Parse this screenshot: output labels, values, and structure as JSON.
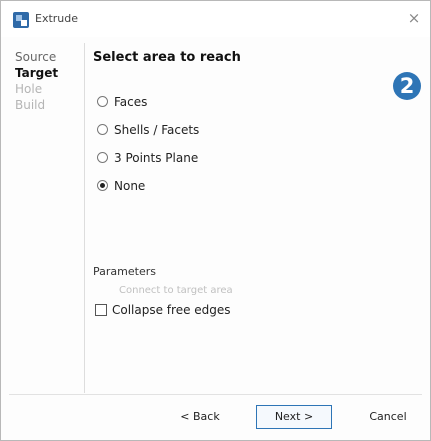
{
  "window": {
    "title": "Extrude",
    "close_glyph": "×"
  },
  "steps": [
    {
      "label": "Source",
      "state": "normal"
    },
    {
      "label": "Target",
      "state": "active"
    },
    {
      "label": "Hole",
      "state": "disabled"
    },
    {
      "label": "Build",
      "state": "disabled"
    }
  ],
  "main": {
    "title": "Select area to reach",
    "step_badge": "2",
    "options": [
      {
        "label": "Faces",
        "checked": false
      },
      {
        "label": "Shells / Facets",
        "checked": false
      },
      {
        "label": "3 Points Plane",
        "checked": false
      },
      {
        "label": "None",
        "checked": true
      }
    ],
    "parameters_label": "Parameters",
    "disabled_option": "Connect to target area",
    "collapse_label": "Collapse free edges",
    "collapse_checked": false
  },
  "footer": {
    "back": "< Back",
    "next": "Next >",
    "cancel": "Cancel"
  },
  "colors": {
    "accent": "#2e75b6",
    "disabled_text": "#b5b5b5"
  }
}
